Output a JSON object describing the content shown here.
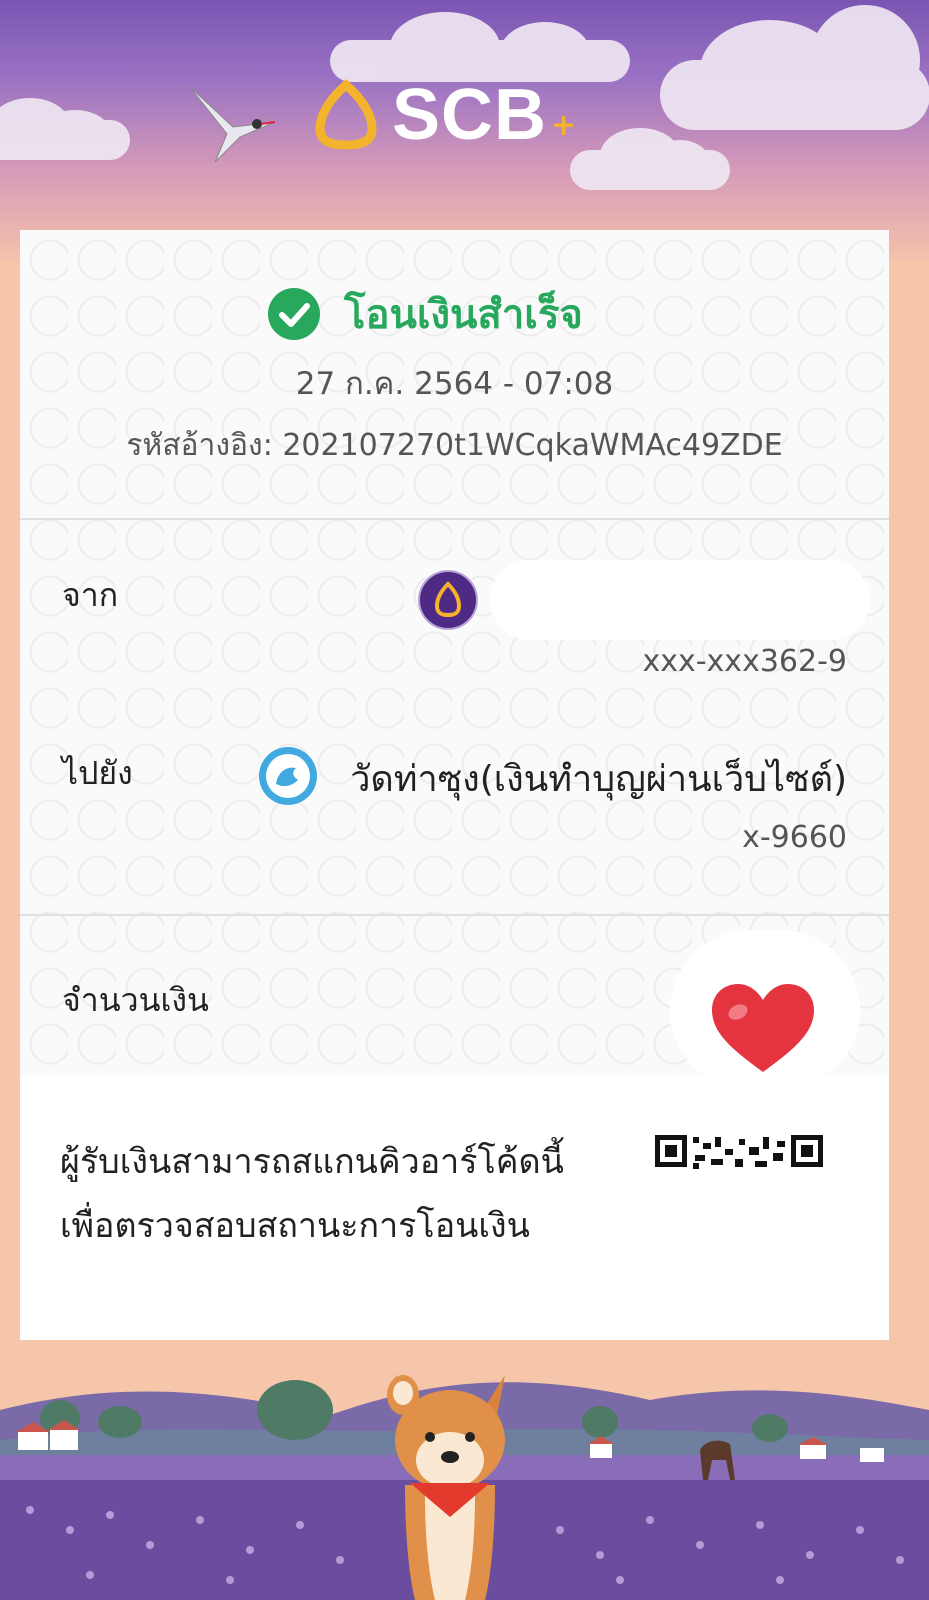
{
  "brand": {
    "name": "SCB",
    "plus": "+"
  },
  "status": {
    "text": "โอนเงินสำเร็จ"
  },
  "transaction": {
    "datetime": "27 ก.ค. 2564 - 07:08",
    "reference": "รหัสอ้างอิง: 202107270t1WCqkaWMAc49ZDE"
  },
  "from": {
    "label": "จาก",
    "account": "xxx-xxx362-9"
  },
  "to": {
    "label": "ไปยัง",
    "name": "วัดท่าซุง(เงินทำบุญผ่านเว็บไซต์)",
    "account": "x-9660"
  },
  "amount": {
    "label": "จำนวนเงิน"
  },
  "note": {
    "line1": "ผู้รับเงินสามารถสแกนคิวอาร์โค้ดนี้",
    "line2": "เพื่อตรวจสอบสถานะการโอนเงิน"
  },
  "icons": [
    "scb-logo-icon",
    "bird-icon",
    "check-circle-icon",
    "scb-bank-icon",
    "ktb-bank-icon",
    "heart-icon",
    "qr-code-icon",
    "shiba-dog-icon"
  ],
  "colors": {
    "brand_purple": "#4e2a84",
    "success_green": "#27a85c",
    "scb_gold": "#f4b32d",
    "heart_red": "#e3343f"
  }
}
